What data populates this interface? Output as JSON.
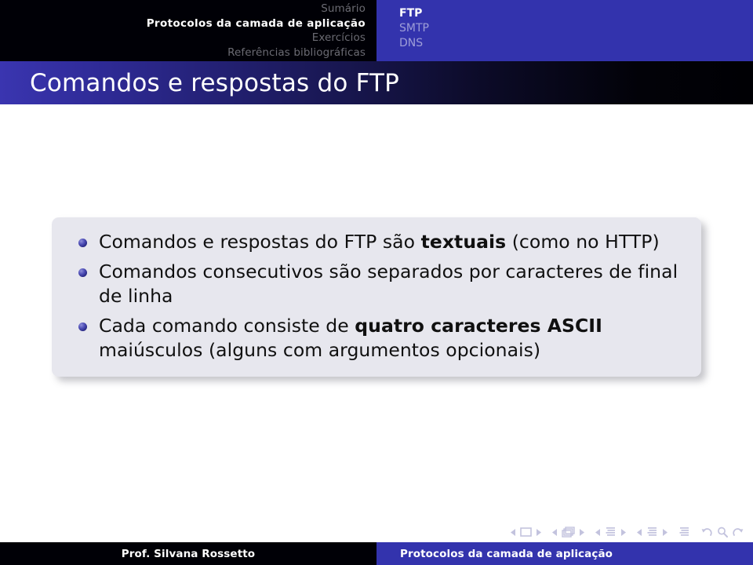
{
  "theme": {
    "structure_blue": "#3333ad",
    "header_black": "#000006",
    "block_bg": "#e7e7ee",
    "inactive_nav": "#6b6b73",
    "inactive_sub": "#9e9ed8",
    "navsymbol_color": "#c3c3de"
  },
  "header": {
    "sections": [
      {
        "label": "Sumário",
        "active": false
      },
      {
        "label": "Protocolos da camada de aplicação",
        "active": true
      },
      {
        "label": "Exercícios",
        "active": false
      },
      {
        "label": "Referências bibliográficas",
        "active": false
      }
    ],
    "subsections": [
      {
        "label": "FTP",
        "active": true
      },
      {
        "label": "SMTP",
        "active": false
      },
      {
        "label": "DNS",
        "active": false
      }
    ]
  },
  "title": {
    "text": "Comandos e respostas do FTP"
  },
  "body": {
    "bullets": [
      {
        "parts": [
          {
            "text": "Comandos e respostas do FTP são ",
            "bold": false
          },
          {
            "text": "textuais",
            "bold": true
          },
          {
            "text": " (como no HTTP)",
            "bold": false
          }
        ]
      },
      {
        "parts": [
          {
            "text": "Comandos consecutivos são separados por caracteres de final de linha",
            "bold": false
          }
        ]
      },
      {
        "parts": [
          {
            "text": "Cada comando consiste de ",
            "bold": false
          },
          {
            "text": "quatro caracteres ASCII",
            "bold": true
          },
          {
            "text": " maiúsculos (alguns com argumentos opcionais)",
            "bold": false
          }
        ]
      }
    ]
  },
  "navsymbols": {
    "groups": [
      {
        "name": "slide-navigation",
        "items": [
          {
            "icon": "triangle-left-icon",
            "name": "previous-slide-button"
          },
          {
            "icon": "slide-icon",
            "name": "slide-indicator"
          },
          {
            "icon": "triangle-right-icon",
            "name": "next-slide-button"
          }
        ]
      },
      {
        "name": "frame-navigation",
        "items": [
          {
            "icon": "triangle-left-icon",
            "name": "previous-frame-button"
          },
          {
            "icon": "frame-stack-icon",
            "name": "frame-indicator"
          },
          {
            "icon": "triangle-right-icon",
            "name": "next-frame-button"
          }
        ]
      },
      {
        "name": "subsection-navigation",
        "items": [
          {
            "icon": "triangle-left-icon",
            "name": "previous-subsection-button"
          },
          {
            "icon": "subsection-icon",
            "name": "subsection-indicator"
          },
          {
            "icon": "triangle-right-icon",
            "name": "next-subsection-button"
          }
        ]
      },
      {
        "name": "section-navigation",
        "items": [
          {
            "icon": "triangle-left-icon",
            "name": "previous-section-button"
          },
          {
            "icon": "section-icon",
            "name": "section-indicator"
          },
          {
            "icon": "triangle-right-icon",
            "name": "next-section-button"
          }
        ]
      },
      {
        "name": "document-navigation",
        "items": [
          {
            "icon": "document-icon",
            "name": "document-button"
          }
        ]
      },
      {
        "name": "history-navigation",
        "items": [
          {
            "icon": "back-arrow-icon",
            "name": "go-back-button"
          },
          {
            "icon": "search-icon",
            "name": "find-button"
          },
          {
            "icon": "forward-arrow-icon",
            "name": "go-forward-button"
          }
        ]
      }
    ]
  },
  "footer": {
    "author": "Prof. Silvana Rossetto",
    "title": "Protocolos da camada de aplicação"
  }
}
